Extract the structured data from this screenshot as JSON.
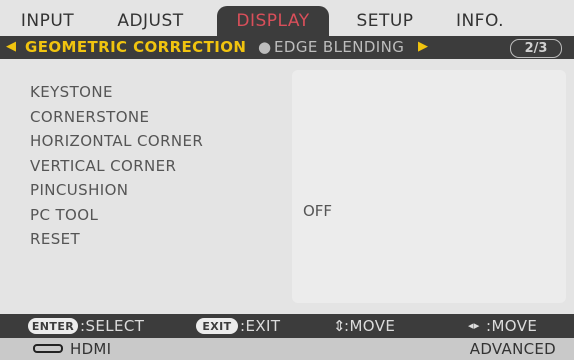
{
  "menu": {
    "tabs": [
      {
        "label": "INPUT",
        "active": false
      },
      {
        "label": "ADJUST",
        "active": false
      },
      {
        "label": "DISPLAY",
        "active": true
      },
      {
        "label": "SETUP",
        "active": false
      },
      {
        "label": "INFO.",
        "active": false
      }
    ],
    "accent_color": "#d94f5a"
  },
  "subbar": {
    "left_arrow": "◀",
    "active_label": "GEOMETRIC CORRECTION",
    "separator": "●",
    "other_label": "EDGE BLENDING",
    "right_arrow": "▶",
    "page_indicator": "2/3",
    "highlight_color": "#f1c40f"
  },
  "items": [
    {
      "label": "KEYSTONE",
      "value": ""
    },
    {
      "label": "CORNERSTONE",
      "value": ""
    },
    {
      "label": "HORIZONTAL CORNER",
      "value": ""
    },
    {
      "label": "VERTICAL CORNER",
      "value": ""
    },
    {
      "label": "PINCUSHION",
      "value": ""
    },
    {
      "label": "PC TOOL",
      "value": "OFF"
    },
    {
      "label": "RESET",
      "value": ""
    }
  ],
  "statusbar": {
    "enter_key": "ENTER",
    "select_label": ":SELECT",
    "exit_key": "EXIT",
    "exit_label": ":EXIT",
    "move_vertical_icon": "up-down-arrows-icon",
    "move_vertical_glyph": "⇕",
    "move_vertical_label": ":MOVE",
    "move_horizontal_icon": "left-right-arrows-icon",
    "move_horizontal_glyph": "◂▸",
    "move_horizontal_label": ":MOVE"
  },
  "infobar": {
    "input_icon": "hdmi-connector-icon",
    "input_label": "HDMI",
    "mode_label": "ADVANCED"
  }
}
